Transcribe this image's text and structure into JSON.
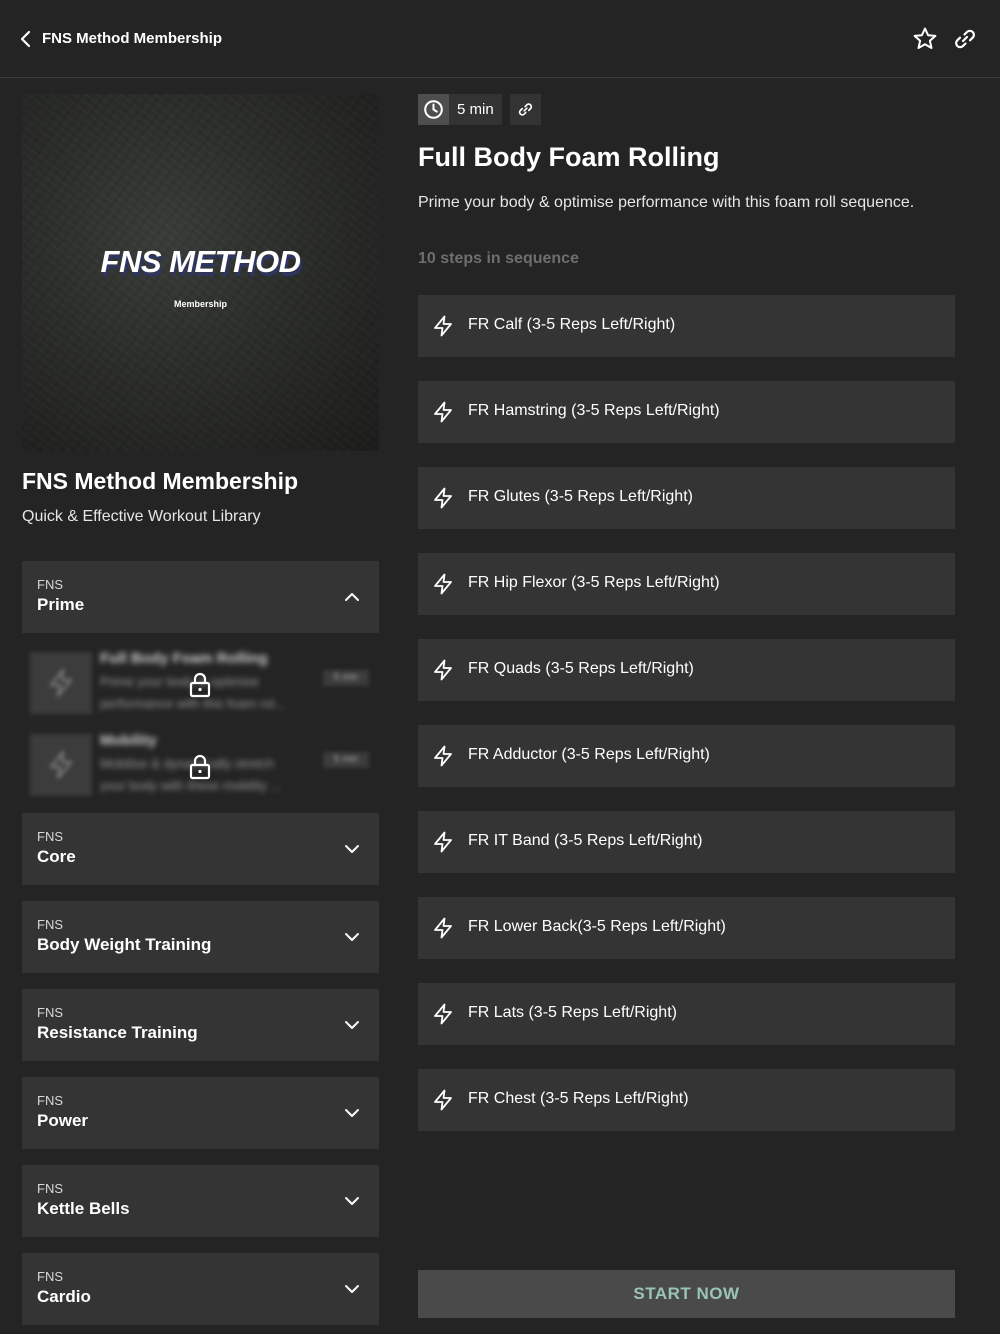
{
  "header": {
    "title": "FNS Method Membership"
  },
  "cover": {
    "logo": "FNS METHOD",
    "subtitle": "Membership"
  },
  "program": {
    "title": "FNS Method Membership",
    "subtitle": "Quick & Effective Workout Library"
  },
  "categories": [
    {
      "label": "FNS",
      "name": "Prime",
      "expanded": true
    },
    {
      "label": "FNS",
      "name": "Core",
      "expanded": false
    },
    {
      "label": "FNS",
      "name": "Body Weight Training",
      "expanded": false
    },
    {
      "label": "FNS",
      "name": "Resistance Training",
      "expanded": false
    },
    {
      "label": "FNS",
      "name": "Power",
      "expanded": false
    },
    {
      "label": "FNS",
      "name": "Kettle Bells",
      "expanded": false
    },
    {
      "label": "FNS",
      "name": "Cardio",
      "expanded": false
    }
  ],
  "locked_items": [
    {
      "title": "Full Body Foam Rolling",
      "line1": "Prime your body & optimise",
      "line2": "performance with this foam rol...",
      "badge": "5 min"
    },
    {
      "title": "Mobility",
      "line1": "Mobilise & dynamically stretch",
      "line2": "your body with these mobility ...",
      "badge": "5 min"
    }
  ],
  "workout": {
    "duration": "5 min",
    "title": "Full Body Foam Rolling",
    "description": "Prime your body & optimise performance with this foam roll sequence.",
    "steps_count": "10 steps in sequence",
    "steps": [
      "FR Calf (3-5 Reps Left/Right)",
      "FR Hamstring (3-5 Reps Left/Right)",
      "FR Glutes (3-5 Reps Left/Right)",
      "FR Hip Flexor (3-5 Reps Left/Right)",
      "FR Quads (3-5 Reps Left/Right)",
      "FR Adductor (3-5 Reps Left/Right)",
      "FR IT Band (3-5 Reps Left/Right)",
      "FR Lower Back(3-5 Reps Left/Right)",
      "FR Lats (3-5 Reps Left/Right)",
      "FR Chest (3-5 Reps Left/Right)"
    ],
    "start_label": "START NOW"
  },
  "colors": {
    "background": "#242424",
    "card": "#343434",
    "start_text": "#9ac4b6"
  },
  "icons": [
    "chevron-left-icon",
    "star-icon",
    "link-icon",
    "clock-icon",
    "lightning-icon",
    "lock-icon",
    "chevron-up-icon",
    "chevron-down-icon"
  ]
}
